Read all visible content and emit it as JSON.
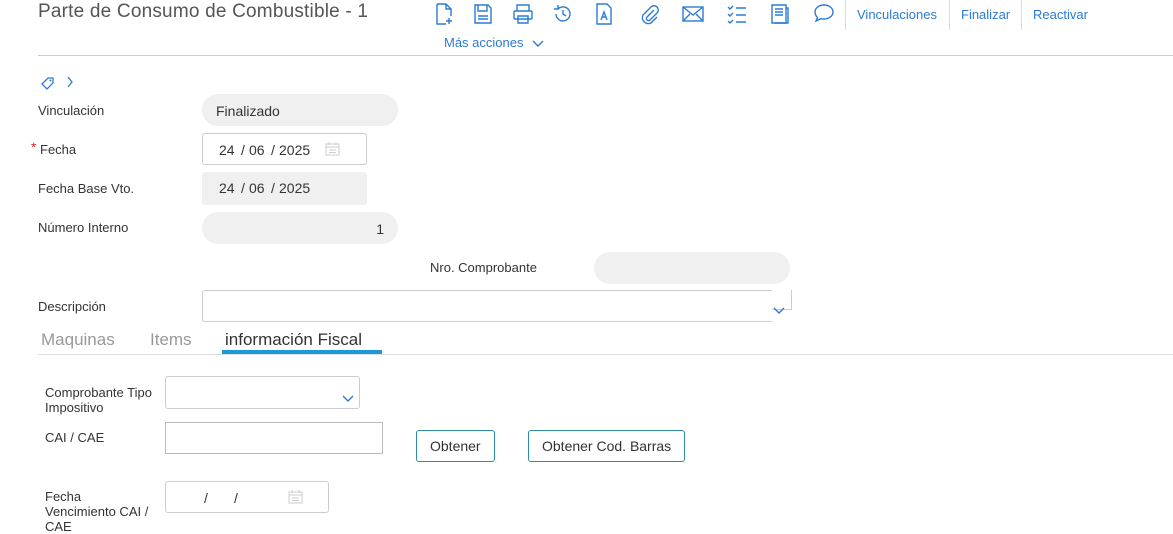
{
  "header": {
    "title": "Parte de Consumo de Combustible - 1",
    "links": [
      "Vinculaciones",
      "Finalizar",
      "Reactivar"
    ],
    "more_actions": "Más acciones"
  },
  "form": {
    "vinculacion": {
      "label": "Vinculación",
      "value": "Finalizado"
    },
    "fecha": {
      "label": "Fecha",
      "required": "*",
      "day": "24",
      "month": "06",
      "year": "2025"
    },
    "fecha_base": {
      "label": "Fecha Base Vto.",
      "day": "24",
      "month": "06",
      "year": "2025"
    },
    "numero_interno": {
      "label": "Número Interno",
      "value": "1"
    },
    "nro_comprobante": {
      "label": "Nro. Comprobante",
      "value": ""
    },
    "descripcion": {
      "label": "Descripción",
      "value": ""
    }
  },
  "tabs": [
    "Maquinas",
    "Items",
    "información Fiscal"
  ],
  "fiscal": {
    "comprobante_tipo": {
      "label": "Comprobante Tipo Impositivo",
      "value": ""
    },
    "cai": {
      "label": "CAI / CAE",
      "value": ""
    },
    "obtener": "Obtener",
    "obtener_barras": "Obtener Cod. Barras",
    "fecha_venc": {
      "label": "Fecha Vencimiento CAI / CAE",
      "slash": "/"
    }
  },
  "colors": {
    "accent": "#2b7bd6",
    "tab_underline": "#1a9bd7"
  }
}
